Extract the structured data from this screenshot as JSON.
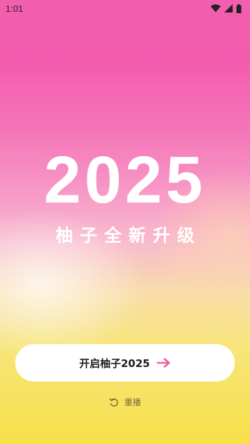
{
  "status_bar": {
    "time": "1:01",
    "icons": [
      "wifi-icon",
      "signal-icon",
      "battery-icon"
    ]
  },
  "hero": {
    "year": "2025",
    "subtitle": "柚子全新升级"
  },
  "start_button": {
    "label": "开启柚子2025",
    "icon": "arrow-right-icon",
    "icon_color": "#f0609f"
  },
  "replay": {
    "label": "重播",
    "icon": "replay-icon"
  },
  "colors": {
    "top": "#f25fae",
    "bottom": "#f6e04a",
    "text": "#ffffff"
  }
}
